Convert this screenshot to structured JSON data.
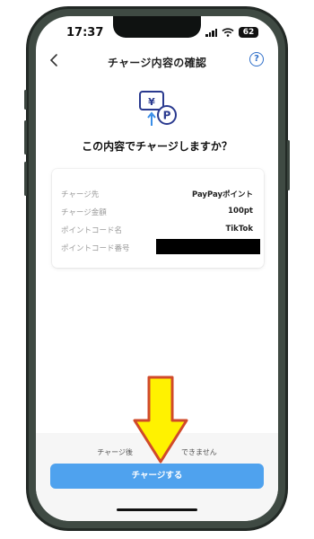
{
  "status_bar": {
    "time": "17:37",
    "battery": "62"
  },
  "nav": {
    "title": "チャージ内容の確認",
    "help": "?"
  },
  "headline": "この内容でチャージしますか？",
  "summary": {
    "rows": [
      {
        "label": "チャージ先",
        "value": "PayPayポイント"
      },
      {
        "label": "チャージ金額",
        "value": "100pt"
      },
      {
        "label": "ポイントコード名",
        "value": "TikTok"
      },
      {
        "label": "ポイントコード番号",
        "value": ""
      }
    ]
  },
  "footer": {
    "notice_left": "チャージ後",
    "notice_right": "できません",
    "button_label": "チャージする"
  },
  "colors": {
    "accent": "#4fa2ee",
    "frame": "#3f4a43",
    "annotation_fill": "#fff200",
    "annotation_stroke": "#d04a2a"
  }
}
